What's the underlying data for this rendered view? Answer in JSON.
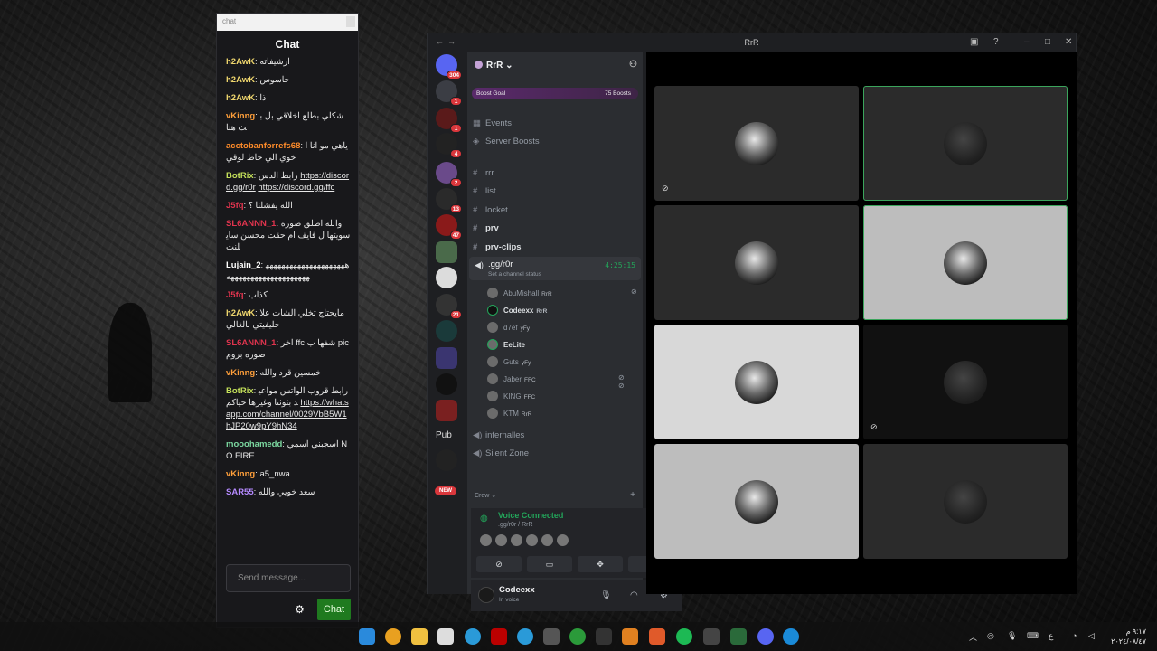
{
  "chat_window": {
    "titlebar_text": "chat",
    "heading": "Chat",
    "messages": [
      {
        "user": "h2AwK",
        "color": "#f0d76e",
        "text": "ارشيفاته"
      },
      {
        "user": "h2AwK",
        "color": "#f0d76e",
        "text": "جاسوس"
      },
      {
        "user": "h2AwK",
        "color": "#f0d76e",
        "text": "ذا"
      },
      {
        "user": "vKinng",
        "color": "#ff9f3a",
        "text": "شكلي بطلع اخلاقي بل بث هنا"
      },
      {
        "user": "acctobanforrefs68",
        "color": "#ff8c2a",
        "text": "ياهي مو انا اخوي الي حاط لوقي"
      },
      {
        "user": "BotRix",
        "color": "#c4e05a",
        "text": "رابط الدس",
        "link": "https://discord.gg/r0r",
        "link2": "https://discord.gg/ffc"
      },
      {
        "user": "J5fq",
        "color": "#e0344e",
        "text": "الله يفشلنا ؟"
      },
      {
        "user": "SL6ANNN_1",
        "color": "#e0344e",
        "text": "والله اطلق صوره سويتها ل فايف ام حقت محسن سايلنت"
      },
      {
        "user": "Lujain_2",
        "color": "#ffffff",
        "text": "هههههههههههههههههههههههههههههههههههههههههه"
      },
      {
        "user": "J5fq",
        "color": "#e0344e",
        "text": "كذاب"
      },
      {
        "user": "h2AwK",
        "color": "#f0d76e",
        "text": "مايحتاج تخلي الشات علا خليفيتي بالغالي"
      },
      {
        "user": "SL6ANNN_1",
        "color": "#e0344e",
        "text": "اخر ffc شفها ب pic صوره بروم"
      },
      {
        "user": "vKinng",
        "color": "#ff9f3a",
        "text": "خمسين قرد والله"
      },
      {
        "user": "BotRix",
        "color": "#c4e05a",
        "text": "رابط قروب الواتس مواعيد بثوثنا وغيرها حياكم",
        "link": "https://whatsapp.com/channel/0029VbB5W1hJP20w9pY9hN34"
      },
      {
        "user": "mooohamedd",
        "color": "#7bd8a0",
        "text": "اسجبني اسمي NO FIRE"
      },
      {
        "user": "vKinng",
        "color": "#ff9f3a",
        "text": "a5_nwa"
      },
      {
        "user": "SAR55",
        "color": "#b58aff",
        "text": "سعد خويي والله"
      }
    ],
    "input_placeholder": "Send message...",
    "send_label": "Chat"
  },
  "discord": {
    "window_title": "RrR",
    "server_name": "RrR",
    "boost_goal_label": "Boost Goal",
    "boost_count_label": "75 Boosts",
    "menu": [
      "Events",
      "Server Boosts"
    ],
    "text_channels": [
      "rrr",
      "list",
      "locket",
      "prv",
      "prv-clips"
    ],
    "active_voice": {
      "name": ".gg/r0r",
      "status": "Set a channel status",
      "timer": "4:25:15",
      "users": [
        {
          "name": "AbuMishall",
          "tag": "RrR"
        },
        {
          "name": "Codeexx",
          "tag": "RrR"
        },
        {
          "name": "d7ef",
          "tag": "yFy"
        },
        {
          "name": "EeLite",
          "tag": ""
        },
        {
          "name": "Guts",
          "tag": "yFy"
        },
        {
          "name": "Jaber",
          "tag": "FFC"
        },
        {
          "name": "KING",
          "tag": "FFC"
        },
        {
          "name": "KTM",
          "tag": "RrR"
        }
      ]
    },
    "other_voice": [
      "infernalles",
      "Silent Zone"
    ],
    "category": "Crew",
    "server_badges": [
      "304",
      "1",
      "1",
      "4",
      "2",
      "13",
      "47",
      "21"
    ],
    "pub_label": "Pub",
    "new_label": "NEW",
    "voice_panel": {
      "title": "Voice Connected",
      "subtitle": ".gg/r0r / RrR"
    },
    "user_panel": {
      "name": "Codeexx",
      "status": "In voice"
    }
  },
  "taskbar": {
    "time": "٩:١٧ م",
    "date": "٢٠٢٤/٠٨/٤٧",
    "lang": "ع"
  },
  "colors": {
    "accent_green": "#23a55a",
    "discord_bg": "#2b2d31",
    "badge_red": "#da373c"
  }
}
